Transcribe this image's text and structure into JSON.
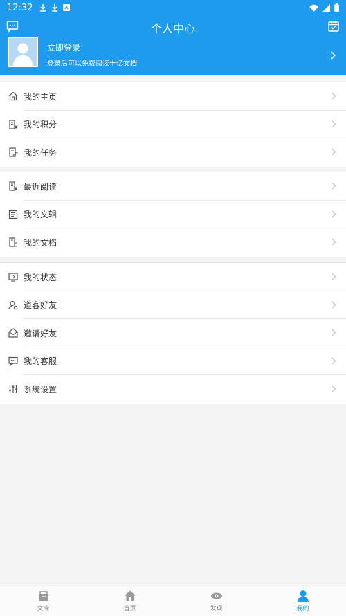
{
  "status_bar": {
    "time": "12:32"
  },
  "header": {
    "title": "个人中心"
  },
  "profile": {
    "login_label": "立即登录",
    "subtitle": "登录后可以免费阅读十亿文档"
  },
  "groups": [
    {
      "items": [
        {
          "label": "我的主页",
          "icon": "home-outline-icon"
        },
        {
          "label": "我的积分",
          "icon": "points-doc-icon"
        },
        {
          "label": "我的任务",
          "icon": "task-edit-icon"
        }
      ]
    },
    {
      "items": [
        {
          "label": "最近阅读",
          "icon": "recent-read-icon"
        },
        {
          "label": "我的文辑",
          "icon": "collection-icon"
        },
        {
          "label": "我的文档",
          "icon": "document-icon"
        }
      ]
    },
    {
      "items": [
        {
          "label": "我的状态",
          "icon": "status-icon"
        },
        {
          "label": "道客好友",
          "icon": "friend-icon"
        },
        {
          "label": "邀请好友",
          "icon": "invite-envelope-icon"
        },
        {
          "label": "我的客服",
          "icon": "customer-service-icon"
        },
        {
          "label": "系统设置",
          "icon": "settings-sliders-icon"
        }
      ]
    }
  ],
  "tabbar": [
    {
      "label": "文库",
      "icon": "library-icon",
      "active": false
    },
    {
      "label": "首页",
      "icon": "home-icon",
      "active": false
    },
    {
      "label": "发现",
      "icon": "discover-icon",
      "active": false
    },
    {
      "label": "我的",
      "icon": "user-icon",
      "active": true
    }
  ],
  "colors": {
    "primary": "#1e9bec",
    "background": "#f4f4f4",
    "text": "#333333",
    "inactive": "#888888"
  }
}
